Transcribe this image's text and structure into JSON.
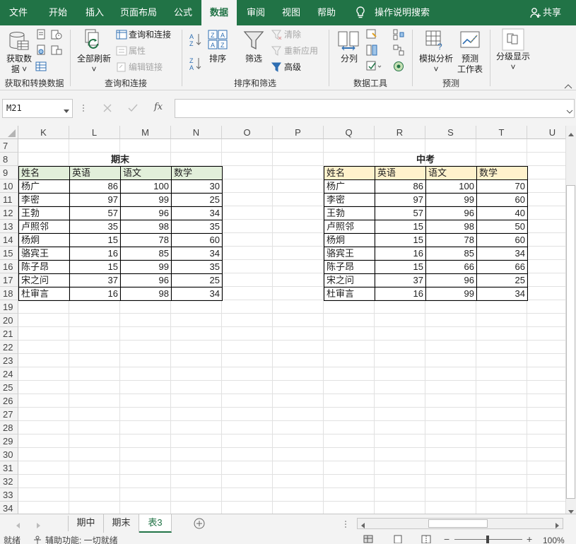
{
  "tabs": {
    "file": "文件",
    "home": "开始",
    "insert": "插入",
    "layout": "页面布局",
    "formulas": "公式",
    "data": "数据",
    "review": "审阅",
    "view": "视图",
    "help": "帮助"
  },
  "tell_me": "操作说明搜索",
  "share": "共享",
  "ribbon": {
    "get_data": "获取数据",
    "get_data_line1": "获取数",
    "get_data_line2": "据 ˅",
    "refresh_all_line1": "全部刷新",
    "refresh_all_line2": "˅",
    "queries_connections": "查询和连接",
    "properties": "属性",
    "edit_links": "编辑链接",
    "sort": "排序",
    "filter": "筛选",
    "clear": "清除",
    "reapply": "重新应用",
    "advanced": "高级",
    "split": "分列",
    "whatif_line1": "模拟分析",
    "whatif_line2": "˅",
    "forecast_line1": "预测",
    "forecast_line2": "工作表",
    "outline_line1": "分级显示",
    "outline_line2": "˅",
    "group_get_transform": "获取和转换数据",
    "group_queries": "查询和连接",
    "group_sort_filter": "排序和筛选",
    "group_data_tools": "数据工具",
    "group_forecast": "预测"
  },
  "formula_bar": {
    "name_box": "M21",
    "fx": "fx",
    "value": ""
  },
  "columns": [
    "K",
    "L",
    "M",
    "N",
    "O",
    "P",
    "Q",
    "R",
    "S",
    "T",
    "U"
  ],
  "rows": [
    "7",
    "8",
    "9",
    "10",
    "11",
    "12",
    "13",
    "14",
    "15",
    "16",
    "17",
    "18",
    "19",
    "20",
    "21",
    "22",
    "23",
    "24",
    "25",
    "26",
    "27",
    "28",
    "29",
    "30",
    "31",
    "32",
    "33",
    "34"
  ],
  "chart_data": [
    {
      "type": "table",
      "title": "期末",
      "header": [
        "姓名",
        "英语",
        "语文",
        "数学"
      ],
      "header_color": "#e2efda",
      "rows": [
        [
          "杨广",
          "86",
          "100",
          "30"
        ],
        [
          "李密",
          "97",
          "99",
          "25"
        ],
        [
          "王勃",
          "57",
          "96",
          "34"
        ],
        [
          "卢照邻",
          "35",
          "98",
          "35"
        ],
        [
          "杨炯",
          "15",
          "78",
          "60"
        ],
        [
          "骆宾王",
          "16",
          "85",
          "34"
        ],
        [
          "陈子昂",
          "15",
          "99",
          "35"
        ],
        [
          "宋之问",
          "37",
          "96",
          "25"
        ],
        [
          "杜审言",
          "16",
          "98",
          "34"
        ]
      ]
    },
    {
      "type": "table",
      "title": "中考",
      "header": [
        "姓名",
        "英语",
        "语文",
        "数学"
      ],
      "header_color": "#fff2cc",
      "rows": [
        [
          "杨广",
          "86",
          "100",
          "70"
        ],
        [
          "李密",
          "97",
          "99",
          "60"
        ],
        [
          "王勃",
          "57",
          "96",
          "40"
        ],
        [
          "卢照邻",
          "15",
          "98",
          "50"
        ],
        [
          "杨炯",
          "15",
          "78",
          "60"
        ],
        [
          "骆宾王",
          "16",
          "85",
          "34"
        ],
        [
          "陈子昂",
          "15",
          "66",
          "66"
        ],
        [
          "宋之问",
          "37",
          "96",
          "25"
        ],
        [
          "杜审言",
          "16",
          "99",
          "34"
        ]
      ]
    }
  ],
  "sheets": [
    "期中",
    "期末",
    "表3"
  ],
  "active_sheet": "表3",
  "status": {
    "ready": "就绪",
    "accessibility": "辅助功能: 一切就绪",
    "zoom": "100%"
  },
  "colors": {
    "accent": "#217346"
  }
}
